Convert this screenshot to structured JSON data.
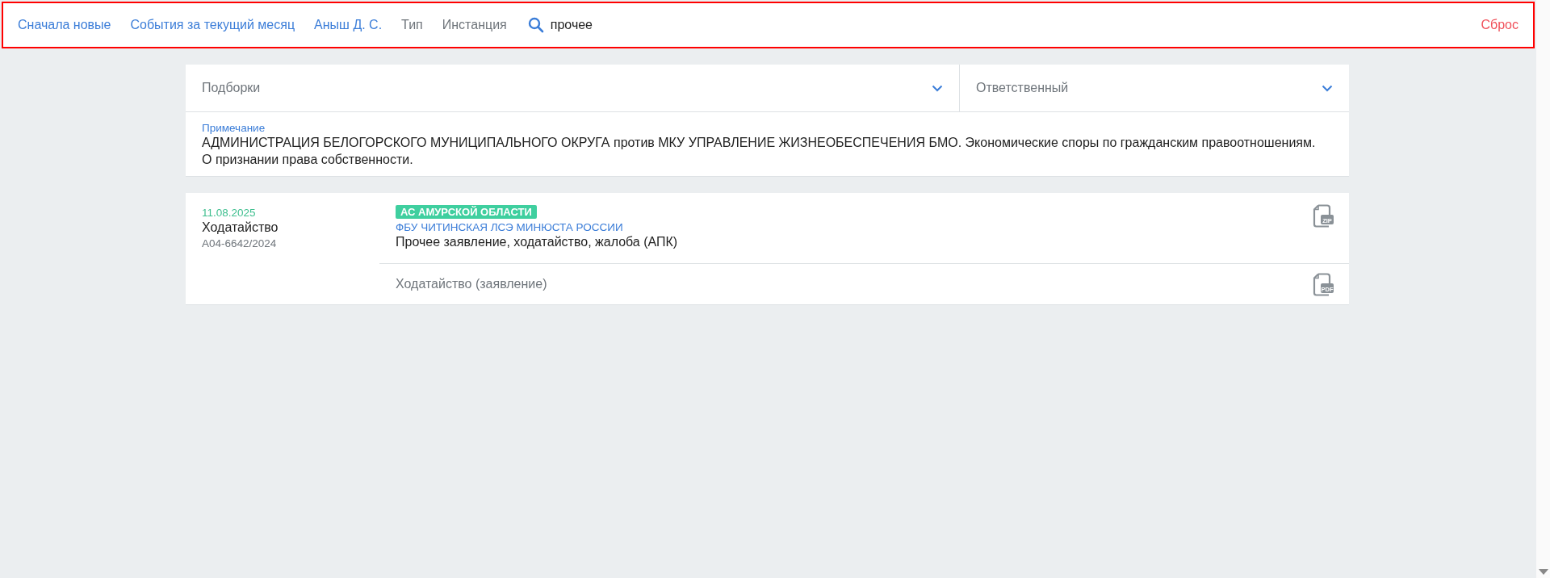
{
  "toolbar": {
    "filters": [
      {
        "label": "Сначала новые",
        "kind": "link"
      },
      {
        "label": "События за текущий месяц",
        "kind": "link"
      },
      {
        "label": "Аныш Д. С.",
        "kind": "link"
      },
      {
        "label": "Тип",
        "kind": "muted"
      },
      {
        "label": "Инстанция",
        "kind": "muted"
      }
    ],
    "search": {
      "value": "прочее"
    },
    "reset": "Сброс"
  },
  "selects": [
    {
      "label": "Подборки"
    },
    {
      "label": "Ответственный"
    }
  ],
  "note": {
    "label": "Примечание",
    "text": "АДМИНИСТРАЦИЯ БЕЛОГОРСКОГО МУНИЦИПАЛЬНОГО ОКРУГА против МКУ УПРАВЛЕНИЕ ЖИЗНЕОБЕСПЕЧЕНИЯ БМО. Экономические споры по гражданским правоотношениям. О признании права собственности."
  },
  "events": [
    {
      "date": "11.08.2025",
      "type": "Ходатайство",
      "case": "А04-6642/2024",
      "documents": [
        {
          "court": "АС АМУРСКОЙ ОБЛАСТИ",
          "party": "ФБУ ЧИТИНСКАЯ ЛСЭ МИНЮСТА РОССИИ",
          "title": "Прочее заявление, ходатайство, жалоба (АПК)",
          "file": "ZIP",
          "kind": "main"
        },
        {
          "title": "Ходатайство (заявление)",
          "file": "PDF",
          "kind": "attachment"
        }
      ]
    }
  ]
}
